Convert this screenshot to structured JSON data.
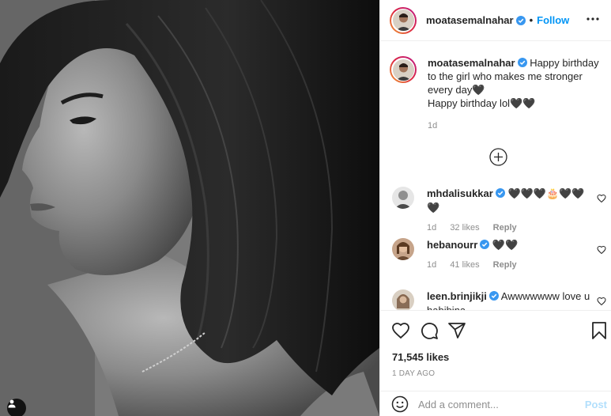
{
  "post": {
    "author": "moatasemalnahar",
    "follow_label": "Follow",
    "separator": "•",
    "caption_line1": "Happy birthday to the girl who makes me stronger every day🖤",
    "caption_line2": "Happy birthday lol🖤🖤",
    "caption_time": "1d",
    "likes": "71,545 likes",
    "timestamp": "1 DAY AGO"
  },
  "comments": [
    {
      "username": "mhdalisukkar",
      "text": "🖤🖤🖤🎂🖤🖤🖤",
      "time": "1d",
      "likes": "32 likes",
      "reply": "Reply",
      "verified": true
    },
    {
      "username": "hebanourr",
      "text": "🖤🖤",
      "time": "1d",
      "likes": "41 likes",
      "reply": "Reply",
      "verified": true
    },
    {
      "username": "leen.brinjikji",
      "text": "Awwwwwww love u habibina",
      "verified": true
    }
  ],
  "composer": {
    "placeholder": "Add a comment...",
    "post_label": "Post"
  },
  "icons": {
    "verified": "verified-badge-icon",
    "more": "more-options-icon",
    "load_more": "plus-circle-icon",
    "like": "heart-icon",
    "comment": "comment-bubble-icon",
    "share": "paper-plane-icon",
    "save": "bookmark-icon",
    "emoji": "smiley-icon",
    "tags": "user-tag-icon"
  },
  "colors": {
    "accent": "#0095f6",
    "verified": "#3897f0",
    "post_disabled": "#b2dffc",
    "muted": "#8e8e8e"
  }
}
